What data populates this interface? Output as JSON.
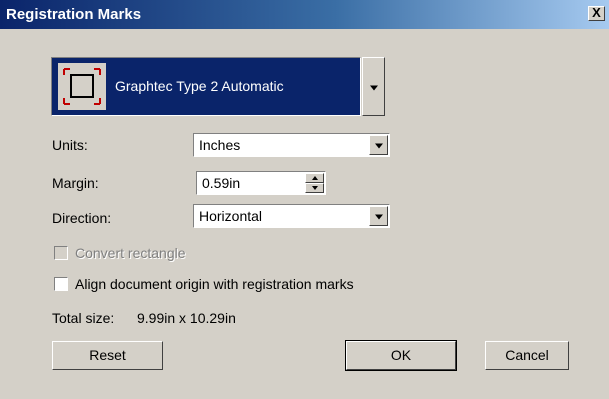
{
  "window": {
    "title": "Registration Marks",
    "close_label": "X"
  },
  "preset": {
    "selected": "Graphtec Type 2 Automatic",
    "icon": "registration-mark-icon"
  },
  "units": {
    "label": "Units:",
    "value": "Inches"
  },
  "margin": {
    "label": "Margin:",
    "value": "0.59in"
  },
  "direction": {
    "label": "Direction:",
    "value": "Horizontal"
  },
  "convert_rectangle": {
    "label": "Convert rectangle",
    "checked": false,
    "enabled": false
  },
  "align_origin": {
    "label": "Align document origin with registration marks",
    "checked": false
  },
  "total_size": {
    "label": "Total size:",
    "value": "9.99in x 10.29in"
  },
  "buttons": {
    "reset": "Reset",
    "ok": "OK",
    "cancel": "Cancel"
  },
  "colors": {
    "title_bar": "#0a246a",
    "selection": "#0a246a",
    "face": "#d4d0c8",
    "mark_red": "#c00000"
  }
}
